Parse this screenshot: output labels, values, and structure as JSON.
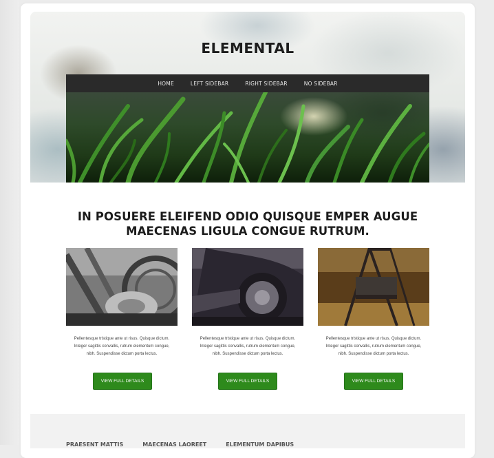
{
  "site": {
    "title": "ELEMENTAL"
  },
  "nav": {
    "items": [
      "HOME",
      "LEFT SIDEBAR",
      "RIGHT SIDEBAR",
      "NO SIDEBAR"
    ]
  },
  "headline": {
    "line1": "IN POSUERE ELEIFEND ODIO QUISQUE EMPER AUGUE",
    "line2": "MAECENAS LIGULA CONGUE RUTRUM."
  },
  "features": [
    {
      "image": "old-tractor-wheel-photo",
      "text_line1": "Pellentesque tristique ante ut risus. Quisque dictum.",
      "text_line2": "Integer sagittis convallis, rutrum elementum congue,",
      "text_line3": "nibh. Suspendisse dictum porta lectus.",
      "button": "VIEW FULL DETAILS"
    },
    {
      "image": "vintage-car-wheel-photo",
      "text_line1": "Pellentesque tristique ante ut risus. Quisque dictum.",
      "text_line2": "Integer sagittis convallis, rutrum elementum congue,",
      "text_line3": "nibh. Suspendisse dictum porta lectus.",
      "button": "VIEW FULL DETAILS"
    },
    {
      "image": "porch-swing-photo",
      "text_line1": "Pellentesque tristique ante ut risus. Quisque dictum.",
      "text_line2": "Integer sagittis convallis, rutrum elementum congue,",
      "text_line3": "nibh. Suspendisse dictum porta lectus.",
      "button": "VIEW FULL DETAILS"
    }
  ],
  "footer": {
    "links": [
      "PRAESENT MATTIS",
      "MAECENAS LAOREET",
      "ELEMENTUM DAPIBUS"
    ]
  },
  "colors": {
    "button_green": "#2e8a1c",
    "nav_bg": "#2a2a2a",
    "heading": "#1c1c1c"
  }
}
